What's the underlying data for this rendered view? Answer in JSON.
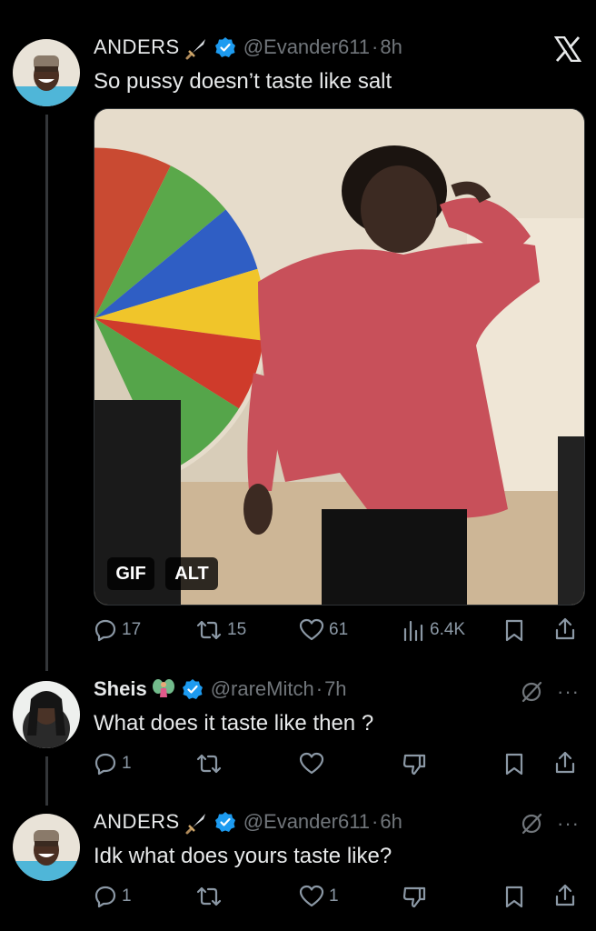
{
  "colors": {
    "background": "#000000",
    "text": "#e7e9ea",
    "muted": "#71767b",
    "verified": "#1d9bf0",
    "thread_line": "#333639"
  },
  "posts": [
    {
      "display_name": "ANDERS",
      "name_emoji": "dagger-icon",
      "handle": "@Evander611",
      "separator": "·",
      "time": "8h",
      "text": "So pussy doesn’t taste like salt",
      "media": {
        "gif_label": "GIF",
        "alt_label": "ALT"
      },
      "stats": {
        "replies": "17",
        "reposts": "15",
        "likes": "61",
        "views": "6.4K"
      }
    },
    {
      "display_name": "Sheis",
      "name_emoji": "fairy-icon",
      "handle": "@rareMitch",
      "separator": "·",
      "time": "7h",
      "text": "What does it taste like then ?",
      "stats": {
        "replies": "1",
        "reposts": "",
        "likes": ""
      }
    },
    {
      "display_name": "ANDERS",
      "name_emoji": "dagger-icon",
      "handle": "@Evander611",
      "separator": "·",
      "time": "6h",
      "text": "Idk what does yours taste like?",
      "stats": {
        "replies": "1",
        "reposts": "",
        "likes": "1"
      }
    }
  ],
  "more_label": "···"
}
